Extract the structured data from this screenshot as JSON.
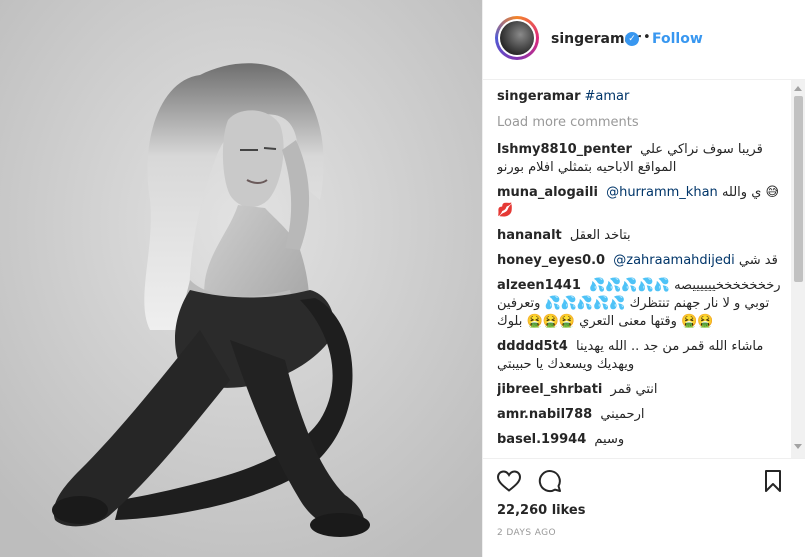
{
  "post": {
    "username": "singeramar",
    "verified_mark": "✓",
    "dot": "•",
    "follow_label": "Follow"
  },
  "caption": {
    "username": "singeramar",
    "hashtag": "#amar"
  },
  "load_more": "Load more comments",
  "comments": [
    {
      "user": "lshmy8810_penter",
      "text": "قريبا سوف نراكي علي المواقع الاباحيه بتمثلي افلام بورنو"
    },
    {
      "user": "muna_alogaili",
      "mention": "@hurramm_khan",
      "text": "ي والله 😅 💋"
    },
    {
      "user": "hananalt",
      "text": "بتاخد العقل"
    },
    {
      "user": "honey_eyes0.0",
      "mention": "@zahraamahdijedi",
      "text": "قد شي"
    },
    {
      "user": "alzeen1441",
      "text": "رخخخخخخخييييييصه 💦💦💦💦💦 توبي و لا نار جهنم تنتظرك 💦💦💦💦💦 وتعرفين وقتها معنى التعري 🤮🤮🤮 بلوك 🤮🤮"
    },
    {
      "user": "ddddd5t4",
      "text": "ماشاء الله قمر من جد .. الله يهدينا ويهديك ويسعدك يا حبيبتي"
    },
    {
      "user": "jibreel_shrbati",
      "text": "انتي قمر"
    },
    {
      "user": "amr.nabil788",
      "text": "ارحميني"
    },
    {
      "user": "basel.19944",
      "text": "وسيم"
    }
  ],
  "actions": {
    "like_icon": "heart-outline-icon",
    "comment_icon": "speech-bubble-icon",
    "save_icon": "bookmark-icon",
    "likes_label": "22,260 likes",
    "timestamp": "2 DAYS AGO"
  },
  "colors": {
    "link_blue": "#3897f0",
    "mention_blue": "#003569",
    "muted_gray": "#999999",
    "text": "#262626"
  }
}
